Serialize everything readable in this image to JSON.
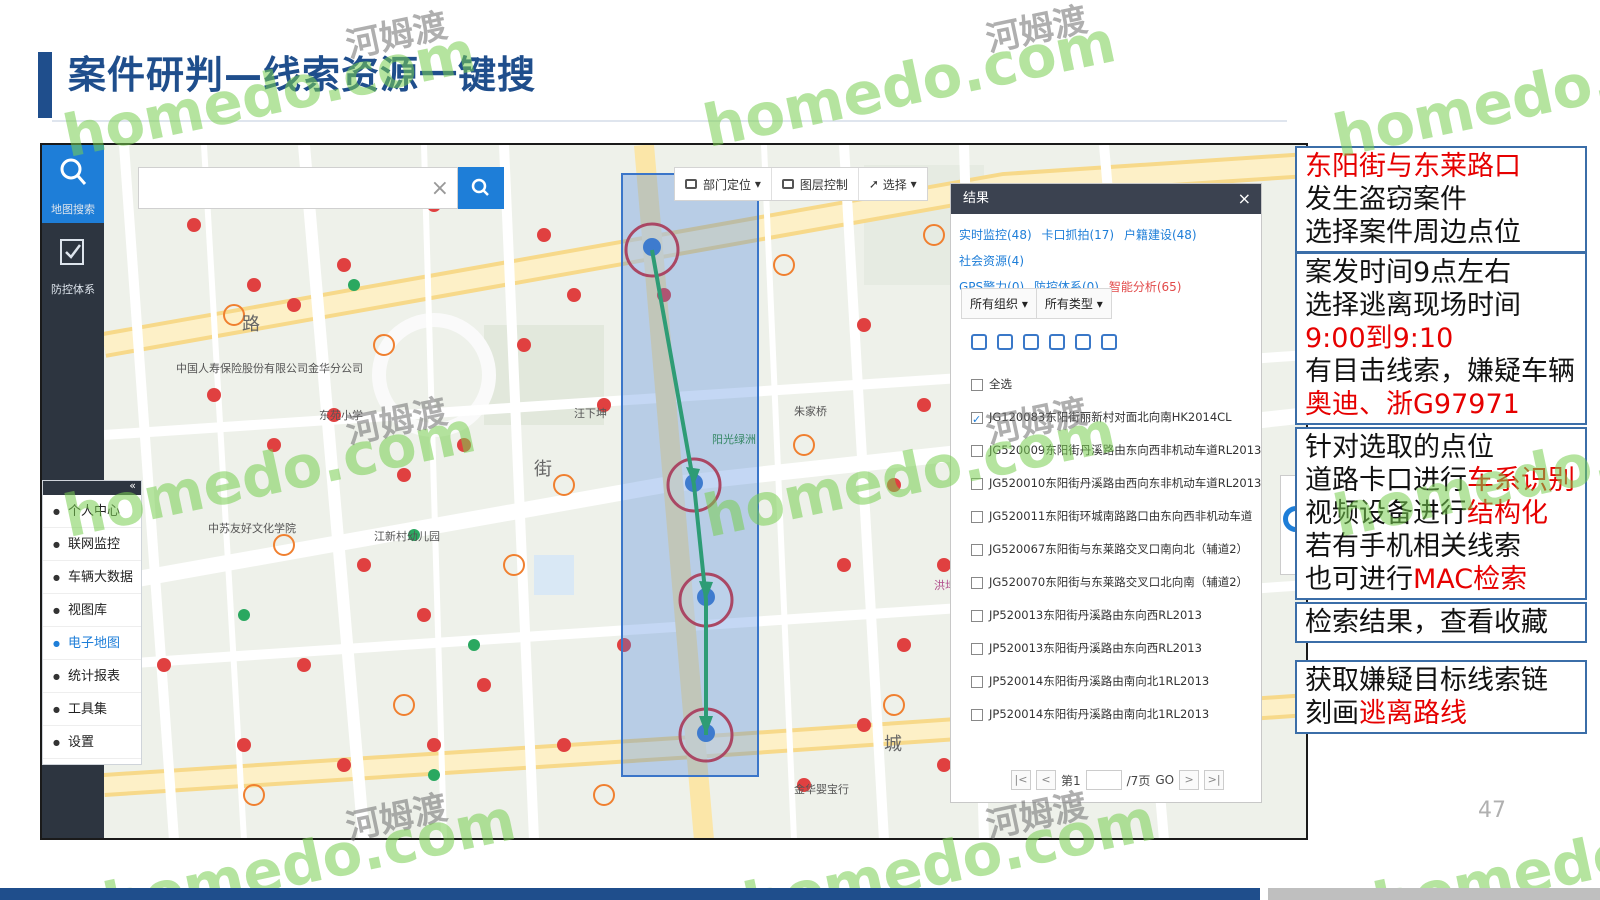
{
  "slide": {
    "title": "案件研判—线索资源一键搜",
    "page_number": "47"
  },
  "watermarks": {
    "en": "homedo.com",
    "cn": "河姆渡"
  },
  "sidebar": {
    "items": [
      {
        "label": "地图搜索",
        "icon": "search-icon"
      },
      {
        "label": "防控体系",
        "icon": "checkbox-icon"
      }
    ]
  },
  "search": {
    "value": "",
    "clear": "×"
  },
  "toolbar": {
    "items": [
      {
        "label": "部门定位"
      },
      {
        "label": "图层控制"
      },
      {
        "label": "选择"
      }
    ]
  },
  "menu": {
    "collapse": "«",
    "items": [
      {
        "label": "个人中心"
      },
      {
        "label": "联网监控"
      },
      {
        "label": "车辆大数据"
      },
      {
        "label": "视图库"
      },
      {
        "label": "电子地图"
      },
      {
        "label": "统计报表"
      },
      {
        "label": "工具集"
      },
      {
        "label": "设置"
      }
    ]
  },
  "map_labels": {
    "insurance": "中国人寿保险股份有限公司金华分公司",
    "school": "东苑小学",
    "kindergarten": "江新村幼儿园",
    "culture": "中苏友好文化学院",
    "park": "阳光绿洲",
    "road1": "路",
    "road2": "街",
    "road3": "城",
    "community": "洪坞社区",
    "bridge": "朱家桥",
    "shop": "金华婴宝行",
    "village": "汪下坤"
  },
  "result_panel": {
    "title": "结果",
    "close": "×",
    "tabs": [
      {
        "label": "实时监控(48)",
        "color": "blue"
      },
      {
        "label": "卡口抓拍(17)",
        "color": "blue"
      },
      {
        "label": "户籍建设(48)",
        "color": "blue"
      },
      {
        "label": "社会资源(4)",
        "color": "blue"
      },
      {
        "label": "GPS警力(0)",
        "color": "blue"
      },
      {
        "label": "防控体系(0)",
        "color": "blue"
      },
      {
        "label": "智能分析(65)",
        "color": "red"
      }
    ],
    "filters": [
      "所有组织",
      "所有类型"
    ],
    "select_all": "全选",
    "rows": [
      {
        "label": "JG120083东阳街丽新村对面北向南HK2014CL",
        "checked": true
      },
      {
        "label": "JG520009东阳街丹溪路由东向西非机动车道RL2013",
        "checked": false
      },
      {
        "label": "JG520010东阳街丹溪路由西向东非机动车道RL2013",
        "checked": false
      },
      {
        "label": "JG520011东阳街环城南路路口由东向西非机动车道",
        "checked": false
      },
      {
        "label": "JG520067东阳街与东莱路交叉口南向北（辅道2）",
        "checked": false
      },
      {
        "label": "JG520070东阳街与东莱路交叉口北向南（辅道2）",
        "checked": false
      },
      {
        "label": "JP520013东阳街丹溪路由东向西RL2013",
        "checked": false
      },
      {
        "label": "JP520013东阳街丹溪路由东向西RL2013",
        "checked": false
      },
      {
        "label": "JP520014东阳街丹溪路由南向北1RL2013",
        "checked": false
      },
      {
        "label": "JP520014东阳街丹溪路由南向北1RL2013",
        "checked": false
      }
    ],
    "pager": {
      "first": "|<",
      "prev": "<",
      "page_prefix": "第1",
      "page_suffix": "/7页",
      "go": "GO",
      "next": ">",
      "last": ">|"
    }
  },
  "annotations": [
    {
      "lines": [
        [
          {
            "t": "东阳街与东莱路口",
            "red": true
          }
        ],
        [
          {
            "t": "发生盗窃案件"
          }
        ],
        [
          {
            "t": "选择案件周边点位"
          }
        ]
      ]
    },
    {
      "lines": [
        [
          {
            "t": "案发时间9点左右"
          }
        ],
        [
          {
            "t": "选择逃离现场时间"
          }
        ],
        [
          {
            "t": "9:00到9:10",
            "red": true
          }
        ],
        [
          {
            "t": "有目击线索，嫌疑车辆"
          }
        ],
        [
          {
            "t": "奥迪、浙G97971",
            "red": true
          }
        ]
      ]
    },
    {
      "lines": [
        [
          {
            "t": "针对选取的点位"
          }
        ],
        [
          {
            "t": "道路卡口进行"
          },
          {
            "t": "车系识别",
            "red": true
          }
        ],
        [
          {
            "t": "视频设备进行"
          },
          {
            "t": "结构化",
            "red": true
          }
        ],
        [
          {
            "t": "若有手机相关线索"
          }
        ],
        [
          {
            "t": "也可进行"
          },
          {
            "t": "MAC检索",
            "red": true
          }
        ]
      ]
    },
    {
      "lines": [
        [
          {
            "t": "检索结果，查看收藏"
          }
        ]
      ]
    },
    {
      "lines": [
        [
          {
            "t": "获取嫌疑目标线索链"
          }
        ],
        [
          {
            "t": "刻画"
          },
          {
            "t": "逃离路线",
            "red": true
          }
        ]
      ]
    }
  ],
  "colors": {
    "brand": "#1f4e8c",
    "accent": "#1e7ed8",
    "route": "#22a845",
    "marker": "#e03a3a",
    "highlight": "#e60000"
  }
}
